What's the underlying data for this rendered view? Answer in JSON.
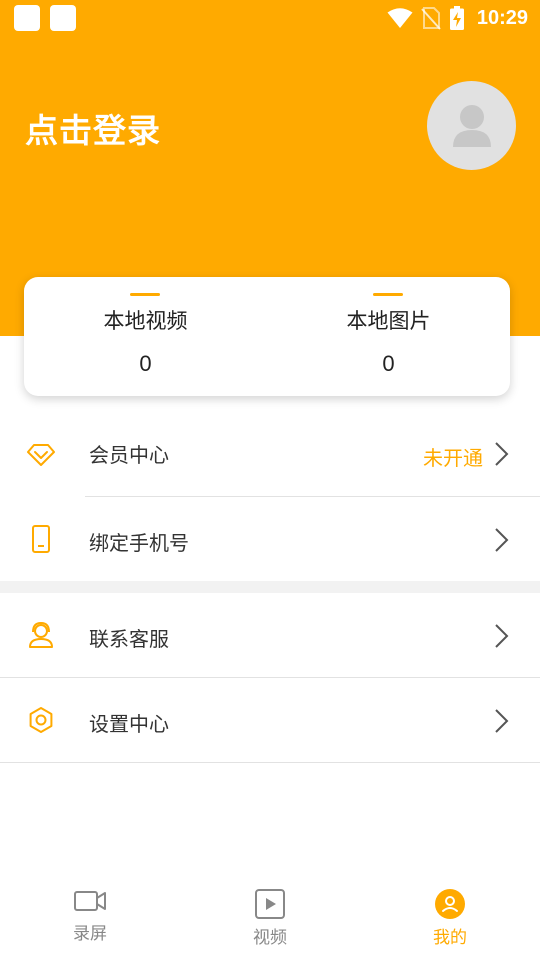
{
  "status_bar": {
    "time": "10:29",
    "icons": [
      "wifi-icon",
      "no-sim-icon",
      "battery-charging-icon"
    ]
  },
  "header": {
    "login_text": "点击登录",
    "avatar_icon": "user-avatar-icon"
  },
  "stats": [
    {
      "label": "本地视频",
      "value": "0"
    },
    {
      "label": "本地图片",
      "value": "0"
    }
  ],
  "menu": {
    "items": [
      {
        "label": "会员中心",
        "status": "未开通",
        "icon": "diamond-icon"
      },
      {
        "label": "绑定手机号",
        "icon": "phone-icon"
      },
      {
        "label": "联系客服",
        "icon": "headset-icon"
      },
      {
        "label": "设置中心",
        "icon": "gear-icon"
      }
    ]
  },
  "tabbar": {
    "tabs": [
      {
        "label": "录屏",
        "icon": "video-camera-icon",
        "active": false
      },
      {
        "label": "视频",
        "icon": "play-icon",
        "active": false
      },
      {
        "label": "我的",
        "icon": "profile-icon",
        "active": true
      }
    ]
  },
  "colors": {
    "accent": "#ffaa00",
    "text": "#333333",
    "muted": "#888888"
  }
}
